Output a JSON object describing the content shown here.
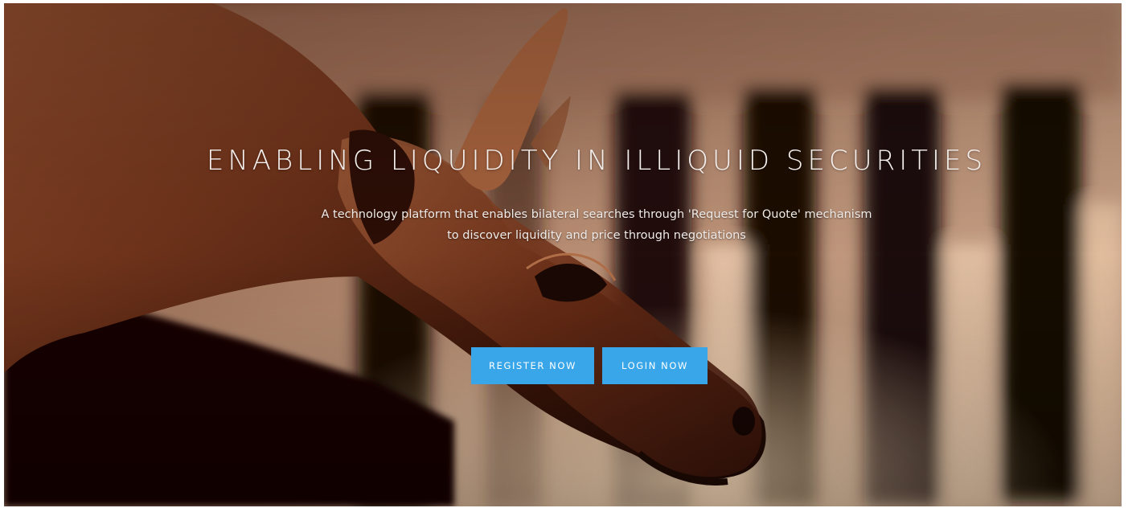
{
  "hero": {
    "headline": "ENABLING LIQUIDITY IN ILLIQUID SECURITIES",
    "subtext_line1": "A technology platform that enables bilateral searches through 'Request for Quote' mechanism",
    "subtext_line2": "to discover liquidity and price through negotiations",
    "background_image": "bronze-bull-statue-with-columns"
  },
  "actions": {
    "register_label": "REGISTER NOW",
    "login_label": "LOGIN NOW"
  },
  "colors": {
    "button": "#3aa6ea",
    "text": "#ffffff"
  }
}
